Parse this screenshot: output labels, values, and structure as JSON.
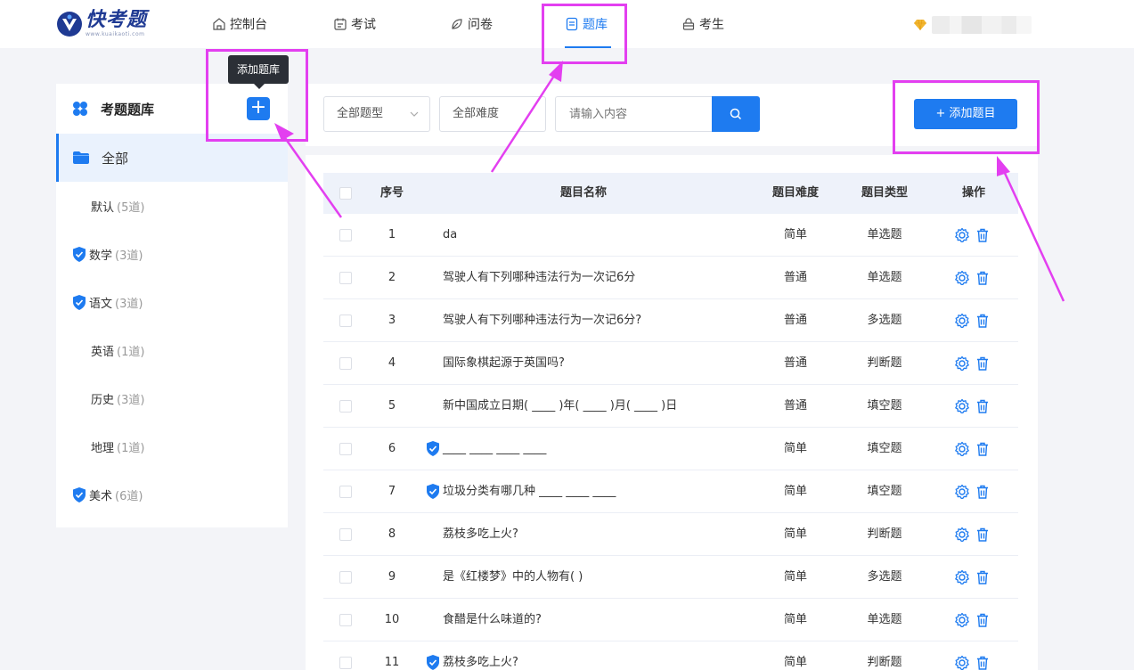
{
  "brand": {
    "name": "快考题",
    "subtitle": "www.kuaikaoti.com"
  },
  "nav": [
    {
      "label": "控制台",
      "icon": "home-icon"
    },
    {
      "label": "考试",
      "icon": "calendar-icon"
    },
    {
      "label": "问卷",
      "icon": "leaf-icon"
    },
    {
      "label": "题库",
      "icon": "document-icon",
      "active": true
    },
    {
      "label": "考生",
      "icon": "lock-icon"
    }
  ],
  "sidebar": {
    "title": "考题题库",
    "add_tooltip": "添加题库",
    "add_label": "+",
    "all_label": "全部",
    "items": [
      {
        "name": "默认",
        "count": "(5道)",
        "verified": false
      },
      {
        "name": "数学",
        "count": "(3道)",
        "verified": true
      },
      {
        "name": "语文",
        "count": "(3道)",
        "verified": true
      },
      {
        "name": "英语",
        "count": "(1道)",
        "verified": false
      },
      {
        "name": "历史",
        "count": "(3道)",
        "verified": false
      },
      {
        "name": "地理",
        "count": "(1道)",
        "verified": false
      },
      {
        "name": "美术",
        "count": "(6道)",
        "verified": true
      }
    ]
  },
  "filters": {
    "type_select": "全部题型",
    "difficulty_select": "全部难度",
    "search_placeholder": "请输入内容",
    "add_question_label": "+ 添加题目"
  },
  "table": {
    "headers": {
      "index": "序号",
      "name": "题目名称",
      "difficulty": "题目难度",
      "type": "题目类型",
      "actions": "操作"
    },
    "rows": [
      {
        "index": "1",
        "name": "da",
        "difficulty": "简单",
        "type": "单选题",
        "verified": false
      },
      {
        "index": "2",
        "name": "驾驶人有下列哪种违法行为一次记6分",
        "difficulty": "普通",
        "type": "单选题",
        "verified": false
      },
      {
        "index": "3",
        "name": "驾驶人有下列哪种违法行为一次记6分?",
        "difficulty": "普通",
        "type": "多选题",
        "verified": false
      },
      {
        "index": "4",
        "name": "国际象棋起源于英国吗?",
        "difficulty": "普通",
        "type": "判断题",
        "verified": false
      },
      {
        "index": "5",
        "name": "新中国成立日期( ____ )年( ____ )月( ____ )日",
        "difficulty": "普通",
        "type": "填空题",
        "verified": false
      },
      {
        "index": "6",
        "name": "____ ____ ____ ____",
        "difficulty": "简单",
        "type": "填空题",
        "verified": true
      },
      {
        "index": "7",
        "name": "垃圾分类有哪几种 ____ ____ ____",
        "difficulty": "简单",
        "type": "填空题",
        "verified": true
      },
      {
        "index": "8",
        "name": "荔枝多吃上火?",
        "difficulty": "简单",
        "type": "判断题",
        "verified": false
      },
      {
        "index": "9",
        "name": "是《红楼梦》中的人物有( )",
        "difficulty": "简单",
        "type": "多选题",
        "verified": false
      },
      {
        "index": "10",
        "name": "食醋是什么味道的?",
        "difficulty": "简单",
        "type": "单选题",
        "verified": false
      },
      {
        "index": "11",
        "name": "荔枝多吃上火?",
        "difficulty": "简单",
        "type": "判断题",
        "verified": true
      }
    ]
  },
  "colors": {
    "primary": "#1e7bf0",
    "highlight": "#e33ff0",
    "page_bg": "#f3f4f8"
  }
}
